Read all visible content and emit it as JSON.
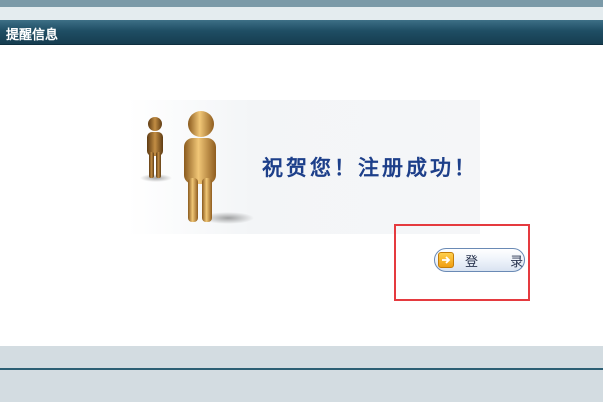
{
  "title_bar": {
    "title": "提醒信息"
  },
  "message": {
    "text": "祝贺您！注册成功！"
  },
  "login_button": {
    "label": "登 录",
    "icon": "arrow-right-icon"
  },
  "colors": {
    "title_bar": "#1f4e64",
    "message_text": "#1d3f8a",
    "highlight_border": "#e53a3f",
    "footer": "#d3dce1"
  }
}
